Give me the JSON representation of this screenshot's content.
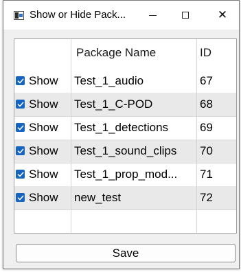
{
  "window": {
    "title": "Show or Hide Pack...",
    "icon": "app-window-icon"
  },
  "titlebar_buttons": {
    "minimize": "minimize-icon",
    "maximize": "maximize-icon",
    "close_glyph": "✕"
  },
  "table": {
    "headers": {
      "show": "",
      "package": "Package Name",
      "id": "ID"
    },
    "rows": [
      {
        "checked": true,
        "show": "Show",
        "package": "Test_1_audio",
        "id": "67"
      },
      {
        "checked": true,
        "show": "Show",
        "package": "Test_1_C-POD",
        "id": "68"
      },
      {
        "checked": true,
        "show": "Show",
        "package": "Test_1_detections",
        "id": "69"
      },
      {
        "checked": true,
        "show": "Show",
        "package": "Test_1_sound_clips",
        "id": "70"
      },
      {
        "checked": true,
        "show": "Show",
        "package": "Test_1_prop_mod...",
        "id": "71"
      },
      {
        "checked": true,
        "show": "Show",
        "package": "new_test",
        "id": "72"
      }
    ]
  },
  "footer": {
    "save_label": "Save"
  },
  "colors": {
    "checkbox": "#1565c0",
    "alt_row": "#e9e9e9"
  }
}
